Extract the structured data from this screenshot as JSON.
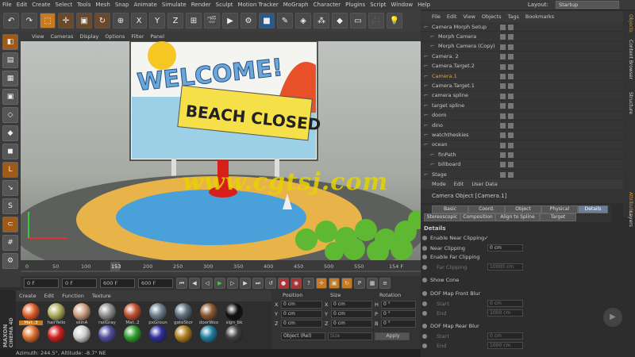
{
  "menu": {
    "items": [
      "File",
      "Edit",
      "Create",
      "Select",
      "Tools",
      "Mesh",
      "Snap",
      "Animate",
      "Simulate",
      "Render",
      "Sculpt",
      "Motion Tracker",
      "MoGraph",
      "Character",
      "Plugins",
      "Script",
      "Window",
      "Help"
    ],
    "layout_label": "Layout:",
    "layout_value": "Startup"
  },
  "viewport_menu": {
    "items": [
      "View",
      "Cameras",
      "Display",
      "Options",
      "Filter",
      "Panel"
    ]
  },
  "scene": {
    "sign_welcome": "WELCOME!",
    "sign_closed": "BEACH CLOSED",
    "watermark": "www.cgtsj.com"
  },
  "timeline": {
    "ticks": [
      "0",
      "50",
      "100",
      "153",
      "200",
      "250",
      "300",
      "350",
      "400",
      "450",
      "500",
      "550"
    ],
    "end_label": "154 F"
  },
  "transport": {
    "start": "0 F",
    "current": "0 F",
    "max_a": "600 F",
    "max_b": "600 F"
  },
  "materials": {
    "menu": [
      "Create",
      "Edit",
      "Function",
      "Texture"
    ],
    "items": [
      {
        "label": "Mat..3",
        "color": "#e0602a"
      },
      {
        "label": "hairYello",
        "color": "#b0b060"
      },
      {
        "label": "skinA",
        "color": "#d0a080"
      },
      {
        "label": "railGray",
        "color": "#909090"
      },
      {
        "label": "Mat..2",
        "color": "#c05030"
      },
      {
        "label": "pxGroun",
        "color": "#708090"
      },
      {
        "label": "gateStor",
        "color": "#607080"
      },
      {
        "label": "doorWoo",
        "color": "#8a5a30"
      },
      {
        "label": "sign_bk",
        "color": "#111111"
      },
      {
        "label": "",
        "color": "#e07030"
      },
      {
        "label": "",
        "color": "#d02020"
      },
      {
        "label": "",
        "color": "#d0d0d0"
      },
      {
        "label": "",
        "color": "#5050a0"
      },
      {
        "label": "",
        "color": "#30a030"
      },
      {
        "label": "",
        "color": "#3030a0"
      },
      {
        "label": "",
        "color": "#b08020"
      },
      {
        "label": "",
        "color": "#2080a0"
      },
      {
        "label": "",
        "color": "#404040"
      }
    ]
  },
  "coords": {
    "headers": [
      "Position",
      "Size",
      "Rotation"
    ],
    "rows": [
      {
        "a": "X",
        "av": "0 cm",
        "b": "X",
        "bv": "0 cm",
        "c": "H",
        "cv": "0 °"
      },
      {
        "a": "Y",
        "av": "0 cm",
        "b": "Y",
        "bv": "0 cm",
        "c": "P",
        "cv": "0 °"
      },
      {
        "a": "Z",
        "av": "0 cm",
        "b": "Z",
        "bv": "0 cm",
        "c": "B",
        "cv": "0 °"
      }
    ],
    "mode": "Object (Rel)",
    "size_mode": "Size",
    "apply": "Apply"
  },
  "status": {
    "text": "Azimuth: 244.5°, Altitude: -8.7° NE"
  },
  "objects": {
    "menu": [
      "File",
      "Edit",
      "View",
      "Objects",
      "Tags",
      "Bookmarks"
    ],
    "rows": [
      {
        "name": "Camera Morph Setup",
        "indent": 0
      },
      {
        "name": "Morph Camera",
        "indent": 1
      },
      {
        "name": "Morph Camera (Copy)",
        "indent": 1
      },
      {
        "name": "Camera. 2",
        "indent": 0
      },
      {
        "name": "Camera.Target.2",
        "indent": 0
      },
      {
        "name": "Camera.1",
        "indent": 0,
        "active": true
      },
      {
        "name": "Camera.Target.1",
        "indent": 0
      },
      {
        "name": "camera spline",
        "indent": 0
      },
      {
        "name": "target spline",
        "indent": 0
      },
      {
        "name": "doom",
        "indent": 0
      },
      {
        "name": "dino",
        "indent": 0
      },
      {
        "name": "watchtheskies",
        "indent": 0
      },
      {
        "name": "ocean",
        "indent": 0
      },
      {
        "name": "finPath",
        "indent": 1
      },
      {
        "name": "billboard",
        "indent": 1
      },
      {
        "name": "Stage",
        "indent": 0
      }
    ]
  },
  "side_tabs": [
    "Objects",
    "Content Browser",
    "Structure",
    "Attributes",
    "Layers"
  ],
  "attributes": {
    "menu": [
      "Mode",
      "Edit",
      "User Data"
    ],
    "title": "Camera Object [Camera.1]",
    "tabs_row1": [
      "Basic",
      "Coord.",
      "Object",
      "Physical",
      "Details"
    ],
    "tabs_row2": [
      "Stereoscopic",
      "Composition",
      "Align to Spline",
      "Target"
    ],
    "active_tab": "Details",
    "section": "Details",
    "fields": [
      {
        "label": "Enable Near Clipping",
        "value": "✓",
        "dim": false
      },
      {
        "label": "Near Clipping",
        "value": "0 cm",
        "dim": false,
        "field": true
      },
      {
        "label": "Enable Far Clipping",
        "value": "",
        "dim": false
      },
      {
        "label": "Far Clipping",
        "value": "10000 cm",
        "dim": true,
        "field": true
      },
      {
        "label": "Show Cone",
        "value": "",
        "dim": false
      },
      {
        "label": "DOF Map Front Blur",
        "value": "",
        "dim": false
      },
      {
        "label": "Start",
        "value": "0 cm",
        "dim": true,
        "field": true
      },
      {
        "label": "End",
        "value": "1000 cm",
        "dim": true,
        "field": true
      },
      {
        "label": "DOF Map Rear Blur",
        "value": "",
        "dim": false
      },
      {
        "label": "Start",
        "value": "0 cm",
        "dim": true,
        "field": true
      },
      {
        "label": "End",
        "value": "1000 cm",
        "dim": true,
        "field": true
      }
    ]
  }
}
